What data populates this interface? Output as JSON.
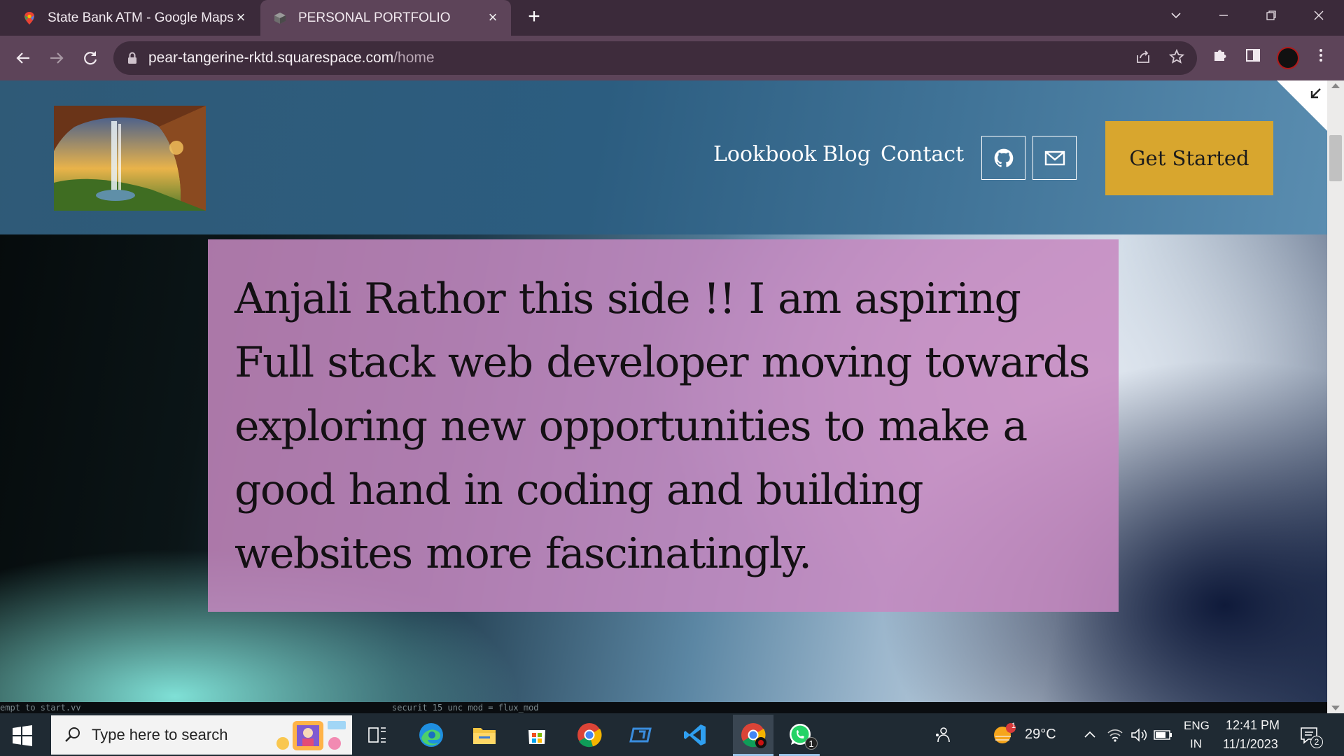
{
  "browser": {
    "tabs": [
      {
        "title": "State Bank ATM - Google Maps",
        "active": false
      },
      {
        "title": "PERSONAL PORTFOLIO",
        "active": true
      }
    ],
    "url_host": "pear-tangerine-rktd.squarespace.com",
    "url_path": "/home"
  },
  "site": {
    "nav": {
      "lookbook": "Lookbook",
      "blog": "Blog",
      "contact": "Contact",
      "cta": "Get Started"
    },
    "intro": "Anjali Rathor this side !!  I am aspiring Full stack web developer moving towards exploring new opportunities to make a good hand in coding and building websites more fascinatingly.",
    "code_strip": [
      "empt to start.vv",
      "securit  15  unc mod  = flux_mod"
    ]
  },
  "taskbar": {
    "search_placeholder": "Type here to search",
    "weather_temp": "29°C",
    "weather_badge": "1",
    "lang_primary": "ENG",
    "lang_secondary": "IN",
    "time": "12:41 PM",
    "date": "11/1/2023",
    "whatsapp_badge": "1",
    "notification_count": "2"
  },
  "colors": {
    "accent_cta": "#d8a62e",
    "intro_box": "#c688c0",
    "header_bg": "#2f5a77",
    "tab_active": "#5d4459"
  }
}
